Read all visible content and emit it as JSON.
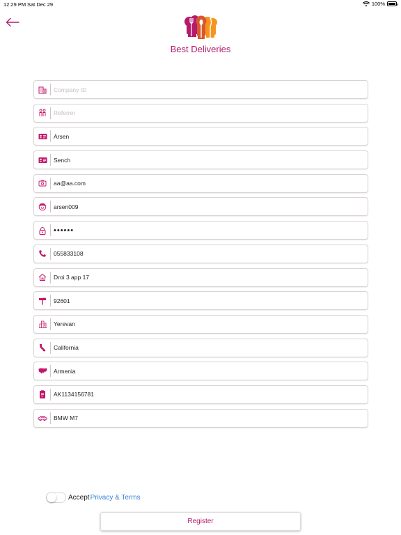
{
  "status_bar": {
    "time": "12:29 PM",
    "date": "Sat Dec 29",
    "battery": "100%"
  },
  "brand": {
    "name": "Best Deliveries",
    "color": "#b51b6c",
    "accent": "#f7941d"
  },
  "form": {
    "fields": [
      {
        "name": "company-id-field",
        "icon": "building-icon",
        "value": "",
        "placeholder": "Company ID"
      },
      {
        "name": "referrer-field",
        "icon": "people-icon",
        "value": "",
        "placeholder": "Referrer"
      },
      {
        "name": "first-name-field",
        "icon": "id-card-icon",
        "value": "Arsen",
        "placeholder": ""
      },
      {
        "name": "last-name-field",
        "icon": "id-card-icon",
        "value": "Sench",
        "placeholder": ""
      },
      {
        "name": "email-field",
        "icon": "mail-icon",
        "value": "aa@aa.com",
        "placeholder": ""
      },
      {
        "name": "username-field",
        "icon": "user-face-icon",
        "value": "arsen009",
        "placeholder": ""
      },
      {
        "name": "password-field",
        "icon": "lock-icon",
        "value": "••••••",
        "placeholder": ""
      },
      {
        "name": "phone-field",
        "icon": "phone-icon",
        "value": "055833108",
        "placeholder": ""
      },
      {
        "name": "address-field",
        "icon": "home-icon",
        "value": "Droi 3 app 17",
        "placeholder": ""
      },
      {
        "name": "zip-field",
        "icon": "mailbox-icon",
        "value": "92601",
        "placeholder": ""
      },
      {
        "name": "city-field",
        "icon": "city-icon",
        "value": "Yerevan",
        "placeholder": ""
      },
      {
        "name": "state-field",
        "icon": "state-map-icon",
        "value": "California",
        "placeholder": ""
      },
      {
        "name": "country-field",
        "icon": "country-map-icon",
        "value": "Armenia",
        "placeholder": ""
      },
      {
        "name": "license-field",
        "icon": "document-icon",
        "value": "AK1134156781",
        "placeholder": ""
      },
      {
        "name": "vehicle-field",
        "icon": "car-icon",
        "value": "BMW M7",
        "placeholder": ""
      }
    ]
  },
  "terms": {
    "accept_label": "Accept",
    "link_label": "Privacy & Terms",
    "accepted": false
  },
  "register": {
    "label": "Register"
  }
}
